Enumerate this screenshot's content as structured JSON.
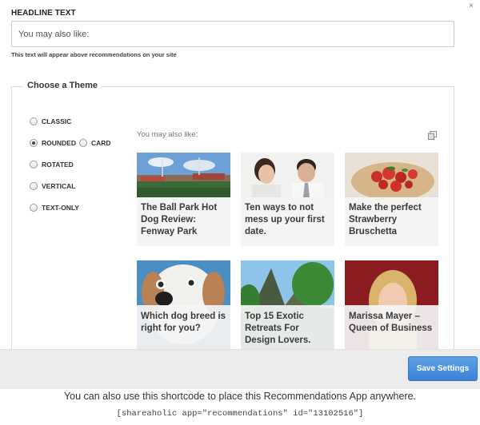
{
  "headline": {
    "label": "HEADLINE TEXT",
    "value": "You may also like:",
    "help": "This text will appear above recommendations on your site"
  },
  "theme": {
    "legend": "Choose a Theme",
    "options": [
      {
        "label": "CLASSIC",
        "checked": false
      },
      {
        "label": "ROUNDED",
        "checked": true
      },
      {
        "label": "CARD",
        "checked": false
      },
      {
        "label": "ROTATED",
        "checked": false
      },
      {
        "label": "VERTICAL",
        "checked": false
      },
      {
        "label": "TEXT-ONLY",
        "checked": false
      }
    ]
  },
  "preview": {
    "title": "You may also like:",
    "cards": [
      {
        "title": "The Ball Park Hot Dog Review: Fenway Park",
        "image": "stadium"
      },
      {
        "title": "Ten ways to not mess up your first date.",
        "image": "couple"
      },
      {
        "title": "Make the perfect Strawberry Bruschetta",
        "image": "bruschetta"
      },
      {
        "title": "Which dog breed is right for you?",
        "image": "dog"
      },
      {
        "title": "Top 15 Exotic Retreats For Design Lovers.",
        "image": "mountain"
      },
      {
        "title": "Marissa Mayer – Queen of Business",
        "image": "woman"
      }
    ]
  },
  "actions": {
    "save_label": "Save Settings"
  },
  "footer": {
    "text": "You can also use this shortcode to place this Recommendations App anywhere.",
    "shortcode": "[shareaholic app=\"recommendations\" id=\"13102516\"]"
  },
  "colors": {
    "accent": "#3b82d4",
    "caption_bg": "#f4f4f4"
  }
}
